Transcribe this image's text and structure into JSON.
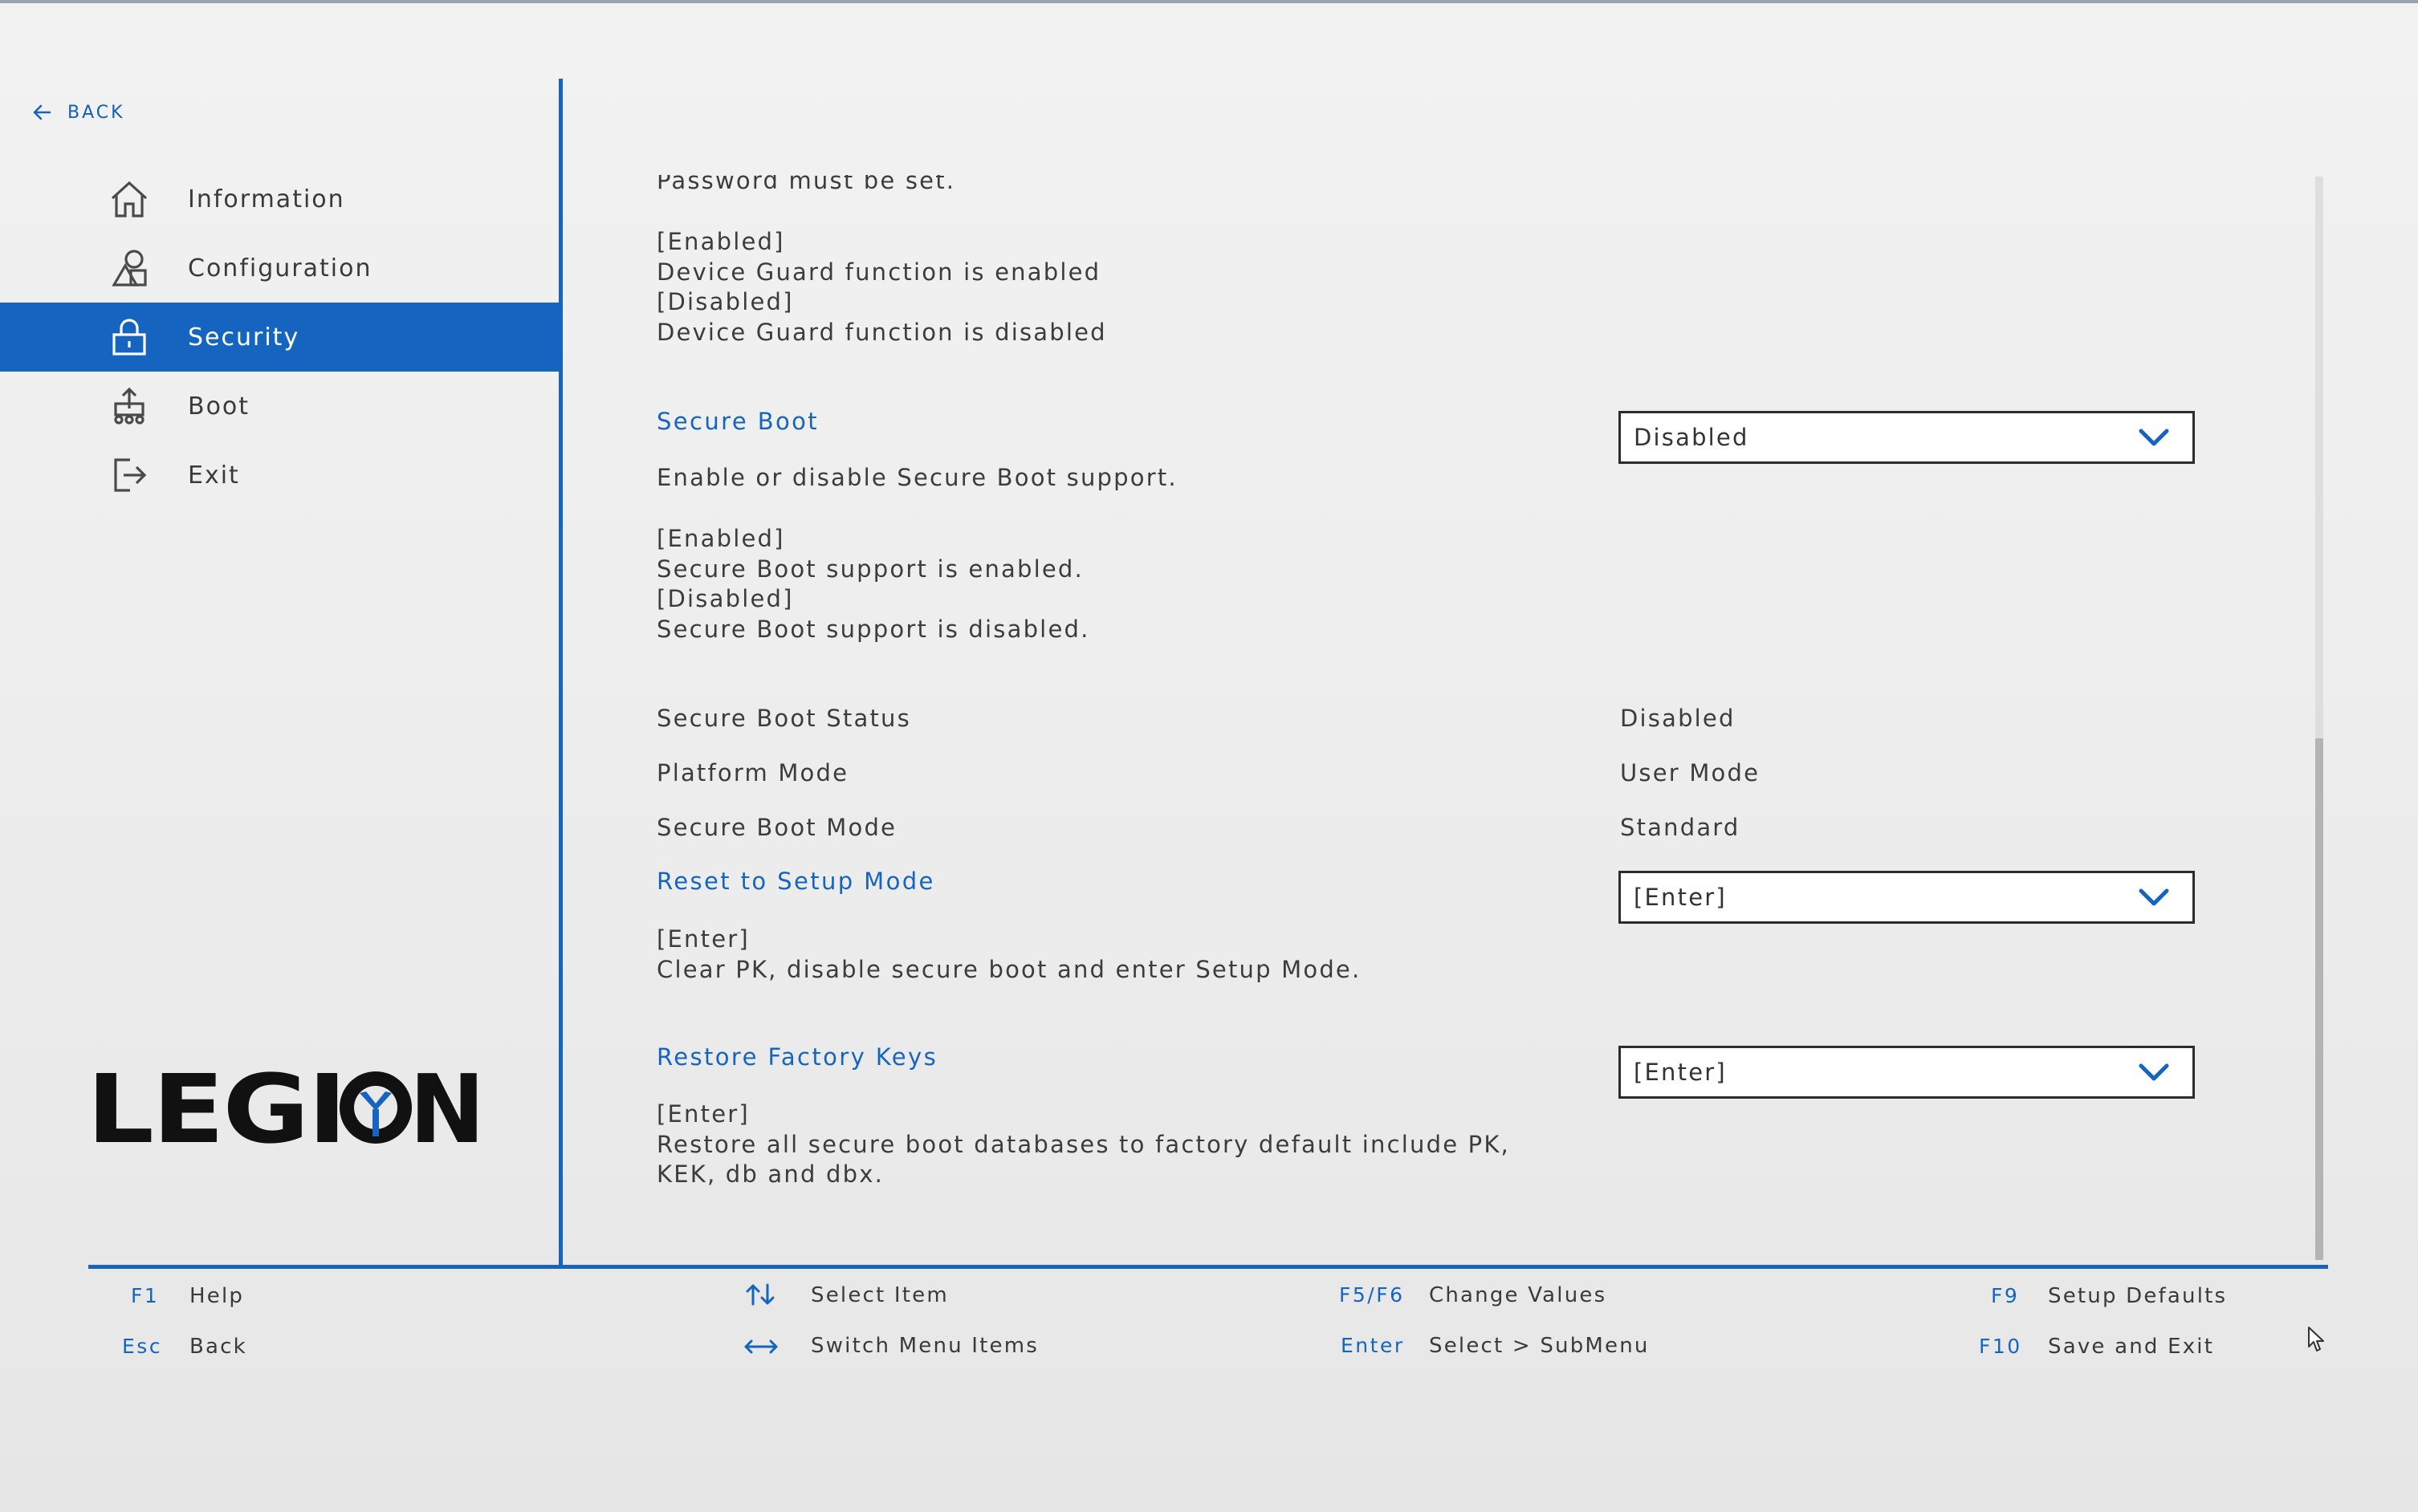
{
  "nav": {
    "back_label": "BACK",
    "items": [
      {
        "label": "Information",
        "icon": "home-icon",
        "active": false
      },
      {
        "label": "Configuration",
        "icon": "shapes-icon",
        "active": false
      },
      {
        "label": "Security",
        "icon": "lock-icon",
        "active": true
      },
      {
        "label": "Boot",
        "icon": "boot-icon",
        "active": false
      },
      {
        "label": "Exit",
        "icon": "exit-icon",
        "active": false
      }
    ],
    "logo_text": "LEGION"
  },
  "content": {
    "partial_line": "Password must be set.",
    "device_guard_help": [
      "[Enabled]",
      "Device Guard function is enabled",
      "[Disabled]",
      "Device Guard function is disabled"
    ],
    "secure_boot": {
      "title": "Secure Boot",
      "value": "Disabled",
      "description": "Enable or disable Secure Boot support.",
      "help": [
        "[Enabled]",
        "Secure Boot support is enabled.",
        "[Disabled]",
        "Secure Boot support is disabled."
      ]
    },
    "status_rows": [
      {
        "label": "Secure Boot Status",
        "value": "Disabled"
      },
      {
        "label": "Platform Mode",
        "value": "User Mode"
      },
      {
        "label": "Secure Boot Mode",
        "value": "Standard"
      }
    ],
    "reset_setup_mode": {
      "title": "Reset to Setup Mode",
      "value": "[Enter]",
      "help": [
        "[Enter]",
        "Clear PK, disable secure boot and enter Setup Mode."
      ]
    },
    "restore_factory_keys": {
      "title": "Restore Factory Keys",
      "value": "[Enter]",
      "help": [
        "[Enter]",
        "Restore all secure boot databases to factory default include PK,",
        "KEK, db and dbx."
      ]
    }
  },
  "footer": {
    "f1_key": "F1",
    "f1_desc": "Help",
    "esc_key": "Esc",
    "esc_desc": "Back",
    "select_item_desc": "Select Item",
    "switch_menu_desc": "Switch Menu Items",
    "f5f6_key": "F5/F6",
    "f5f6_desc": "Change Values",
    "enter_key": "Enter",
    "enter_desc": "Select > SubMenu",
    "f9_key": "F9",
    "f9_desc": "Setup Defaults",
    "f10_key": "F10",
    "f10_desc": "Save and Exit"
  },
  "colors": {
    "accent": "#1565c0",
    "background": "#ececec",
    "text": "#3c3c3c"
  }
}
